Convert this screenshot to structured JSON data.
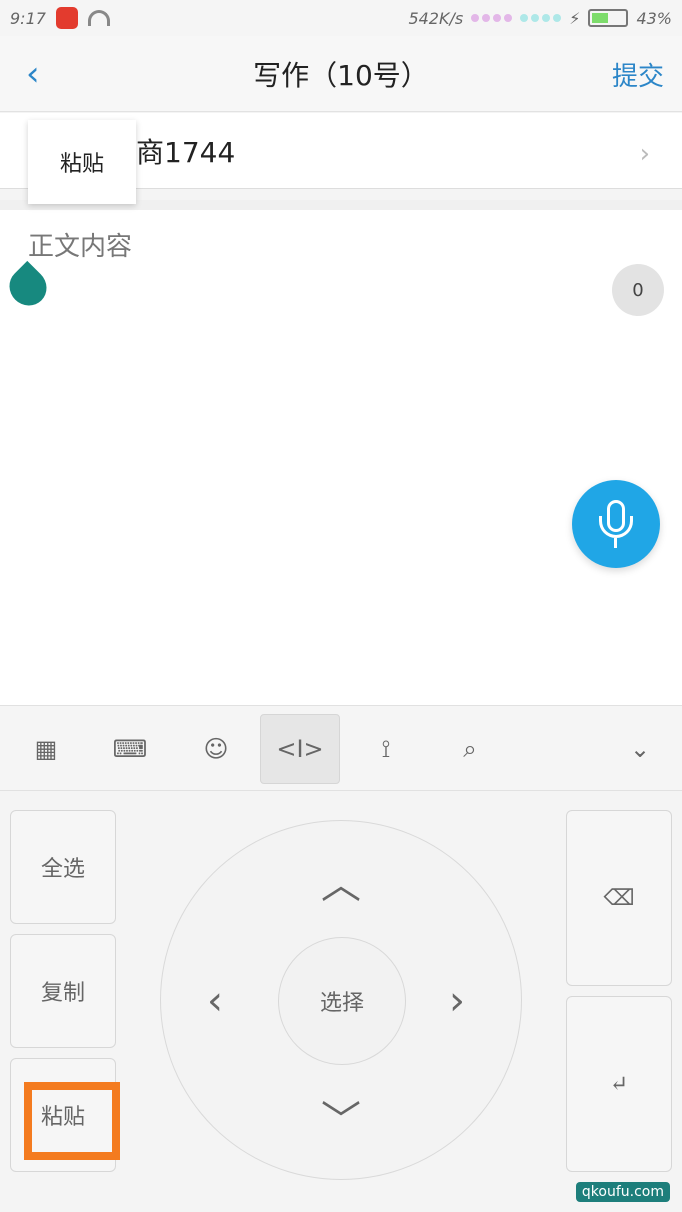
{
  "status_bar": {
    "time": "9:17",
    "net_speed": "542K/s",
    "battery": "43%"
  },
  "header": {
    "back_icon": "chevron-left-icon",
    "title": "写作（10号）",
    "submit_label": "提交"
  },
  "subject": {
    "text": "商1744"
  },
  "paste_popup": {
    "label": "粘贴"
  },
  "editor": {
    "placeholder": "正文内容",
    "char_count": "0"
  },
  "toolbar": {
    "items": [
      {
        "icon": "grid-icon"
      },
      {
        "icon": "keyboard-icon"
      },
      {
        "icon": "emoji-icon"
      },
      {
        "icon": "text-cursor-icon",
        "active": true
      },
      {
        "icon": "link-icon"
      },
      {
        "icon": "search-icon"
      },
      {
        "icon": "chevron-down-icon"
      }
    ]
  },
  "keyboard": {
    "select_all": "全选",
    "copy": "复制",
    "paste": "粘贴",
    "select": "选择",
    "backspace_icon": "backspace-icon",
    "enter_icon": "enter-icon"
  },
  "watermark": {
    "text": "qkoufu.com"
  },
  "colors": {
    "accent": "#2c86c8",
    "mic": "#20a6e6",
    "cursor": "#17897f",
    "highlight": "#f47b1f"
  }
}
